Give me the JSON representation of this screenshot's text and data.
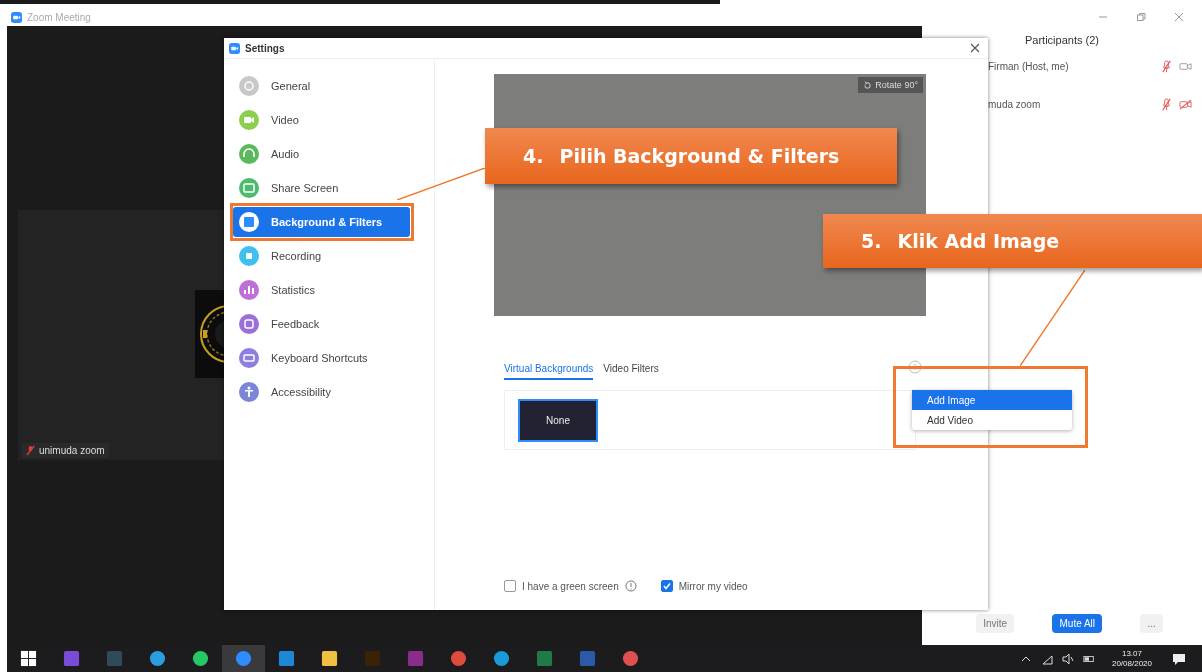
{
  "meeting_window": {
    "title": "Zoom Meeting"
  },
  "video_tile": {
    "name": "unimuda zoom",
    "muted": true
  },
  "participants": {
    "title": "Participants (2)",
    "rows": [
      {
        "name": "Firman (Host, me)",
        "muted": true,
        "video_off": false
      },
      {
        "name": "muda zoom",
        "muted": true,
        "video_off": true
      }
    ],
    "buttons": [
      {
        "label": "Invite",
        "kind": "plain"
      },
      {
        "label": "Mute All",
        "kind": "primary"
      },
      {
        "label": "...",
        "kind": "plain"
      }
    ]
  },
  "settings": {
    "title": "Settings",
    "sidebar": [
      {
        "label": "General",
        "kind": "general",
        "color": "#c8c8c8",
        "selected": false
      },
      {
        "label": "Video",
        "kind": "video",
        "color": "#8ccf4d",
        "selected": false
      },
      {
        "label": "Audio",
        "kind": "audio",
        "color": "#5cb85c",
        "selected": false
      },
      {
        "label": "Share Screen",
        "kind": "share",
        "color": "#4cbb6c",
        "selected": false
      },
      {
        "label": "Background & Filters",
        "kind": "background",
        "color": "#2d8cff",
        "selected": true
      },
      {
        "label": "Recording",
        "kind": "recording",
        "color": "#3fc1f0",
        "selected": false
      },
      {
        "label": "Statistics",
        "kind": "statistics",
        "color": "#c06fd8",
        "selected": false
      },
      {
        "label": "Feedback",
        "kind": "feedback",
        "color": "#9b6fd8",
        "selected": false
      },
      {
        "label": "Keyboard Shortcuts",
        "kind": "keyboard",
        "color": "#8f7ee0",
        "selected": false
      },
      {
        "label": "Accessibility",
        "kind": "accessibility",
        "color": "#7b86d8",
        "selected": false
      }
    ],
    "preview": {
      "rotate_label": "Rotate 90°"
    },
    "tabs": [
      {
        "label": "Virtual Backgrounds",
        "selected": true
      },
      {
        "label": "Video Filters",
        "selected": false
      }
    ],
    "backgrounds": [
      {
        "label": "None",
        "selected": true
      }
    ],
    "green_screen": {
      "label": "I have a green screen",
      "checked": false
    },
    "mirror": {
      "label": "Mirror my video",
      "checked": true
    }
  },
  "menu": [
    {
      "label": "Add Image",
      "selected": true
    },
    {
      "label": "Add Video",
      "selected": false
    }
  ],
  "callouts": [
    {
      "number": "4.",
      "text": "Pilih Background & Filters"
    },
    {
      "number": "5.",
      "text": "Klik Add Image"
    }
  ],
  "taskbar": {
    "apps": [
      {
        "kind": "windows",
        "selected": false
      },
      {
        "kind": "vs",
        "selected": false
      },
      {
        "kind": "dark",
        "selected": false
      },
      {
        "kind": "telegram",
        "selected": false
      },
      {
        "kind": "whatsapp",
        "selected": false
      },
      {
        "kind": "zoom",
        "selected": true
      },
      {
        "kind": "mail",
        "selected": false
      },
      {
        "kind": "folder",
        "selected": false
      },
      {
        "kind": "illustrator",
        "selected": false
      },
      {
        "kind": "g",
        "selected": false
      },
      {
        "kind": "chrome",
        "selected": false
      },
      {
        "kind": "edge",
        "selected": false
      },
      {
        "kind": "excel",
        "selected": false
      },
      {
        "kind": "word",
        "selected": false
      },
      {
        "kind": "paint",
        "selected": false
      }
    ],
    "time": "13.07",
    "date": "20/08/2020"
  }
}
